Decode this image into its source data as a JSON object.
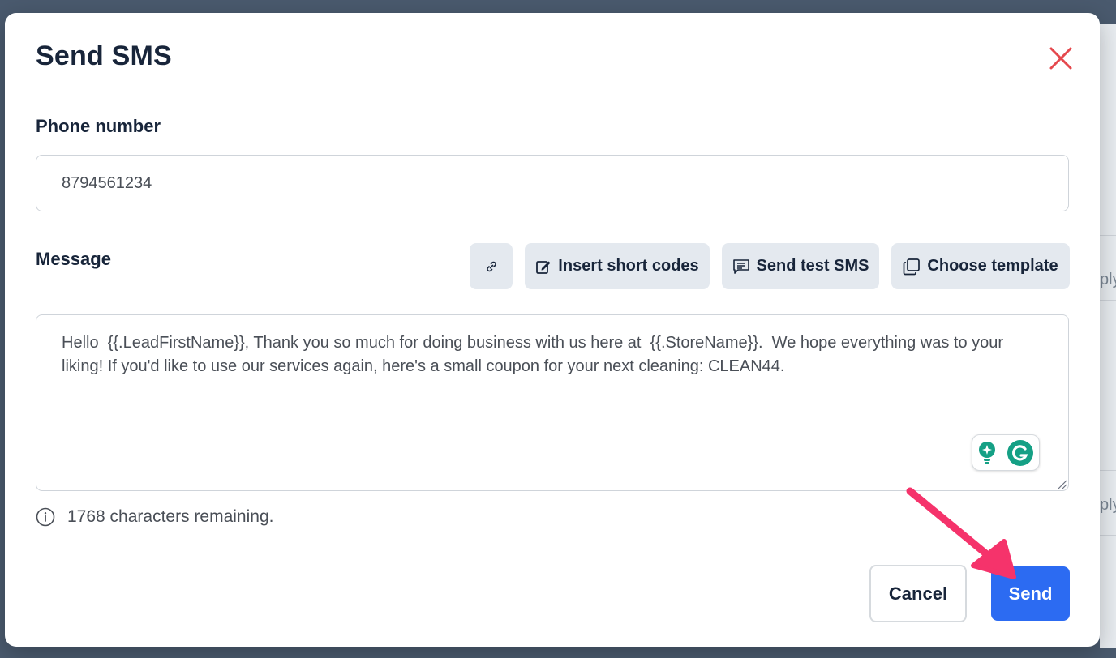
{
  "modal": {
    "title": "Send SMS",
    "close_icon": "close-icon",
    "accent_color": "#2c6bf2",
    "close_color": "#e5484d"
  },
  "phone": {
    "label": "Phone number",
    "value": "8794561234"
  },
  "message": {
    "label": "Message",
    "value": "Hello  {{.LeadFirstName}}, Thank you so much for doing business with us here at  {{.StoreName}}.  We hope everything was to your liking! If you'd like to use our services again, here's a small coupon for your next cleaning: CLEAN44.",
    "toolbar": {
      "link_icon": "link-icon",
      "insert_short_codes": "Insert short codes",
      "send_test_sms": "Send test SMS",
      "choose_template": "Choose template"
    },
    "remaining": "1768 characters remaining.",
    "info_icon": "info-icon",
    "grammarly_icons": [
      "lightbulb-icon",
      "grammarly-icon"
    ]
  },
  "footer": {
    "cancel_label": "Cancel",
    "send_label": "Send"
  },
  "backdrop": {
    "partial_text": "ply"
  },
  "annotation": {
    "arrow_icon": "arrow-pointer-icon",
    "arrow_color": "#f5336b"
  }
}
